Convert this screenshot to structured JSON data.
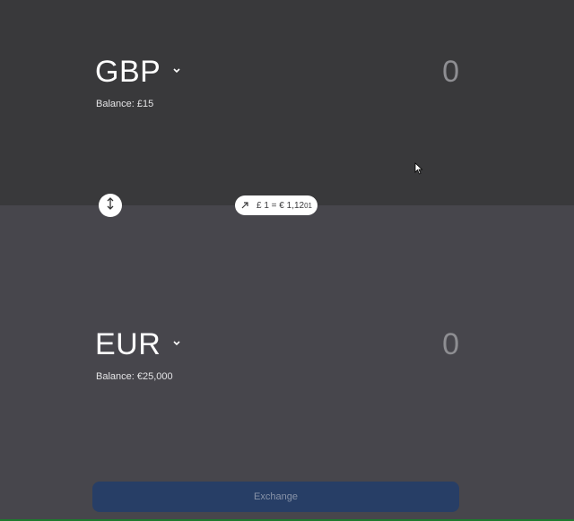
{
  "from": {
    "currency": "GBP",
    "amount": "0",
    "balance": "Balance: £15",
    "dropdown_icon": "chevron-down-icon"
  },
  "to": {
    "currency": "EUR",
    "amount": "0",
    "balance": "Balance: €25,000",
    "dropdown_icon": "chevron-down-icon"
  },
  "swap": {
    "icon": "swap-vertical-icon"
  },
  "rate": {
    "icon": "trend-arrow-icon",
    "main": "£ 1 = € 1,12",
    "small": "01"
  },
  "exchange_button": {
    "label": "Exchange"
  },
  "colors": {
    "top_panel": "#39393b",
    "bottom_panel": "#47464c",
    "exchange_button": "#273e66",
    "amount_text": "#8e8e92"
  }
}
